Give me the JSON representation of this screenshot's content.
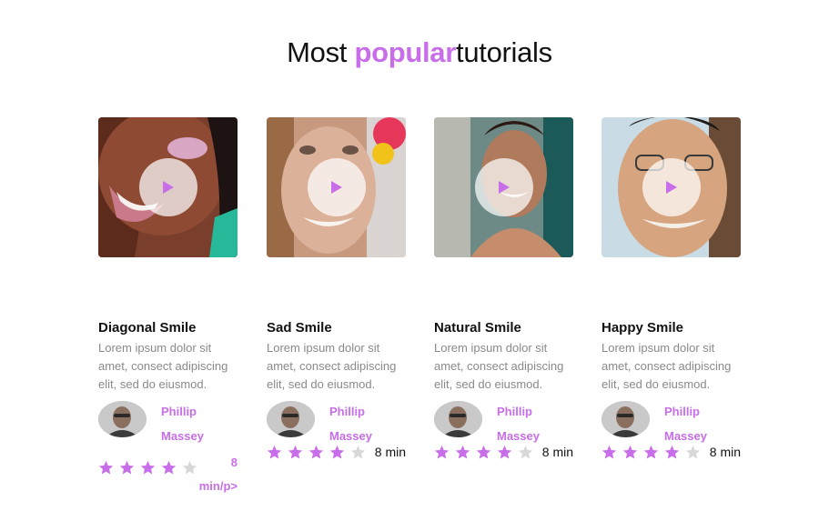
{
  "header": {
    "title_prefix": "Most ",
    "title_accent": "popular",
    "title_suffix": "tutorials"
  },
  "colors": {
    "accent": "#c86ee8",
    "star_filled": "#c86ee8",
    "star_empty": "#d8d8d8",
    "desc": "#8a8a8a"
  },
  "tutorials": [
    {
      "title": "Diagonal Smile",
      "description": "Lorem ipsum dolor sit amet, consect adipiscing elit, sed do eiusmod.",
      "author_first": "Phillip",
      "author_last": "Massey",
      "duration": "8 min/p>",
      "rating": 4,
      "rating_max": 5
    },
    {
      "title": "Sad Smile",
      "description": "Lorem ipsum dolor sit amet, consect adipiscing elit, sed do eiusmod.",
      "author_first": "Phillip",
      "author_last": "Massey",
      "duration": "8 min",
      "rating": 4,
      "rating_max": 5
    },
    {
      "title": "Natural Smile",
      "description": "Lorem ipsum dolor sit amet, consect adipiscing elit, sed do eiusmod.",
      "author_first": "Phillip",
      "author_last": "Massey",
      "duration": "8 min",
      "rating": 4,
      "rating_max": 5
    },
    {
      "title": "Happy Smile",
      "description": "Lorem ipsum dolor sit amet, consect adipiscing elit, sed do eiusmod.",
      "author_first": "Phillip",
      "author_last": "Massey",
      "duration": "8 min",
      "rating": 4,
      "rating_max": 5
    }
  ],
  "icons": {
    "play": "play-icon",
    "star": "star-icon",
    "avatar": "avatar"
  }
}
